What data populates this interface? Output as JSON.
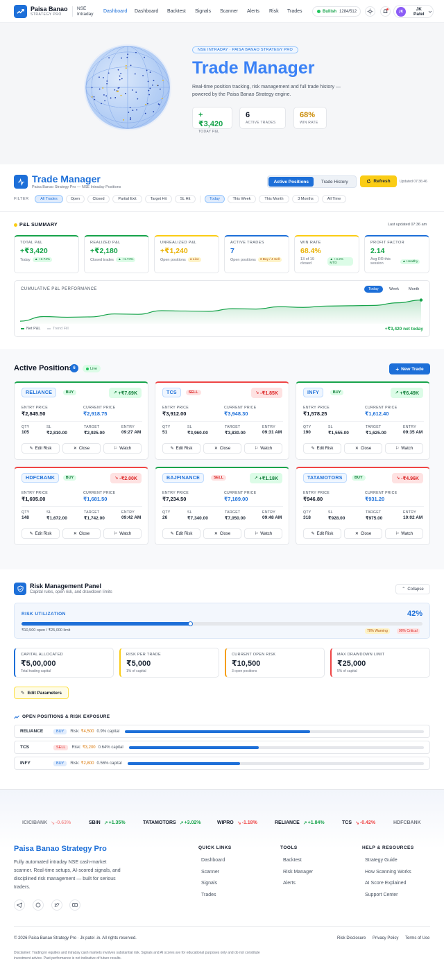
{
  "header": {
    "brand_title": "Paisa Banao",
    "brand_sub": "STRATEGY PRO",
    "market_line1": "NSE",
    "market_line2": "Intraday",
    "nav": [
      "Dashboard",
      "Dashboard",
      "Backtest",
      "Signals",
      "Scanner",
      "Alerts",
      "Risk",
      "Trades"
    ],
    "market_status": "Bullish",
    "market_count": "1284/512",
    "user_initials": "JK",
    "user_name_1": "JK",
    "user_name_2": "Patel"
  },
  "hero": {
    "tag": "NSE INTRADAY · PAISA BANAO STRATEGY PRO",
    "title": "Trade Manager",
    "desc": "Real-time position tracking, risk management and full trade history — powered by the Paisa Banao Strategy engine.",
    "stats": [
      {
        "value": "+₹3,420",
        "label": "TODAY P&L",
        "color": "#16a34a"
      },
      {
        "value": "6",
        "label": "ACTIVE TRADES",
        "color": "#111827"
      },
      {
        "value": "68%",
        "label": "WIN RATE",
        "color": "#ca8a04"
      }
    ]
  },
  "manager": {
    "title": "Trade Manager",
    "subtitle": "Paisa Banao Strategy Pro — NSE Intraday Positions",
    "tab_active": "Active Positions",
    "tab_history": "Trade History",
    "refresh": "Refresh",
    "updated": "Updated 07:36:46",
    "filter_label": "FILTER",
    "filters": [
      "All Trades",
      "Open",
      "Closed",
      "Partial Exit",
      "Target Hit",
      "SL Hit"
    ],
    "periods": [
      "Today",
      "This Week",
      "This Month",
      "3 Months",
      "All Time"
    ]
  },
  "pnl": {
    "title": "P&L SUMMARY",
    "updated": "Last updated 07:36 am",
    "cards": [
      {
        "label": "TOTAL P&L",
        "value": "+₹3,420",
        "sub": "Today",
        "pill": "▲ +2.74%",
        "color": "#16a34a",
        "top": "#16a34a",
        "pill_bg": "#dcfce7",
        "pill_fg": "#15803d"
      },
      {
        "label": "REALIZED P&L",
        "value": "+₹2,180",
        "sub": "Closed trades",
        "pill": "▲ +1.74%",
        "color": "#16a34a",
        "top": "#16a34a",
        "pill_bg": "#dcfce7",
        "pill_fg": "#15803d"
      },
      {
        "label": "UNREALIZED P&L",
        "value": "+₹1,240",
        "sub": "Open positions",
        "pill": "● Live",
        "color": "#eab308",
        "top": "#facc15",
        "pill_bg": "#fef3c7",
        "pill_fg": "#b45309"
      },
      {
        "label": "ACTIVE TRADES",
        "value": "7",
        "sub": "Open positions",
        "pill": "3 Buy / 4 Sell",
        "color": "#1d6fd8",
        "top": "#1d6fd8",
        "pill_bg": "#fef3c7",
        "pill_fg": "#b45309"
      },
      {
        "label": "WIN RATE",
        "value": "68.4%",
        "sub": "13 of 19 closed",
        "pill": "▲ +4.2% MTD",
        "color": "#eab308",
        "top": "#facc15",
        "pill_bg": "#dcfce7",
        "pill_fg": "#15803d"
      },
      {
        "label": "PROFIT FACTOR",
        "value": "2.14",
        "sub": "Avg RR this session",
        "pill": "▲ Healthy",
        "color": "#16a34a",
        "top": "#1d6fd8",
        "pill_bg": "#dcfce7",
        "pill_fg": "#15803d"
      }
    ],
    "chart_title": "CUMULATIVE P&L PERFORMANCE",
    "chart_tabs": [
      "Today",
      "Week",
      "Month"
    ],
    "legend_net": "Net P&L",
    "legend_trend": "Trend Fill",
    "net_today": "+₹3,420 net today"
  },
  "positions": {
    "title": "Active Positions",
    "count": "6",
    "live": "Live",
    "new_trade": "New Trade",
    "labels": {
      "entry": "ENTRY PRICE",
      "current": "CURRENT PRICE",
      "qty": "QTY",
      "sl": "SL",
      "target": "TARGET",
      "entry_t": "ENTRY"
    },
    "btn_edit": "Edit Risk",
    "btn_close": "Close",
    "btn_watch": "Watch",
    "items": [
      {
        "symbol": "RELIANCE",
        "side": "BUY",
        "pnl": "+₹7.69K",
        "entry": "₹2,845.50",
        "current": "₹2,918.75",
        "qty": "105",
        "sl": "₹2,810.00",
        "target": "₹2,925.00",
        "time": "09:27 AM"
      },
      {
        "symbol": "TCS",
        "side": "SELL",
        "pnl": "-₹1.85K",
        "entry": "₹3,912.00",
        "current": "₹3,948.30",
        "qty": "51",
        "sl": "₹3,960.00",
        "target": "₹3,830.00",
        "time": "09:31 AM"
      },
      {
        "symbol": "INFY",
        "side": "BUY",
        "pnl": "+₹6.49K",
        "entry": "₹1,578.25",
        "current": "₹1,612.40",
        "qty": "190",
        "sl": "₹1,555.00",
        "target": "₹1,625.00",
        "time": "09:35 AM"
      },
      {
        "symbol": "HDFCBANK",
        "side": "BUY",
        "pnl": "-₹2.00K",
        "entry": "₹1,695.00",
        "current": "₹1,681.50",
        "qty": "148",
        "sl": "₹1,672.00",
        "target": "₹1,742.00",
        "time": "09:42 AM"
      },
      {
        "symbol": "BAJFINANCE",
        "side": "SELL",
        "pnl": "+₹1.18K",
        "entry": "₹7,234.50",
        "current": "₹7,189.00",
        "qty": "26",
        "sl": "₹7,340.00",
        "target": "₹7,050.00",
        "time": "09:48 AM"
      },
      {
        "symbol": "TATAMOTORS",
        "side": "BUY",
        "pnl": "-₹4.96K",
        "entry": "₹946.80",
        "current": "₹931.20",
        "qty": "318",
        "sl": "₹928.00",
        "target": "₹975.00",
        "time": "10:02 AM"
      }
    ]
  },
  "risk": {
    "title": "Risk Management Panel",
    "subtitle": "Capital rules, open risk, and drawdown limits",
    "collapse": "Collapse",
    "util_label": "RISK UTILIZATION",
    "util_value": "42%",
    "util_fraction": 0.42,
    "util_sub": "₹10,500 open / ₹25,000 limit",
    "warn": "70% Warning",
    "crit": "90% Critical",
    "cards": [
      {
        "label": "CAPITAL ALLOCATED",
        "value": "₹5,00,000",
        "sub": "Total trading capital",
        "accent": "#1d6fd8"
      },
      {
        "label": "RISK PER TRADE",
        "value": "₹5,000",
        "sub": "1% of capital",
        "accent": "#facc15"
      },
      {
        "label": "CURRENT OPEN RISK",
        "value": "₹10,500",
        "sub": "3 open positions",
        "accent": "#f59e0b"
      },
      {
        "label": "MAX DRAWDOWN LIMIT",
        "value": "₹25,000",
        "sub": "5% of capital",
        "accent": "#ef4444"
      }
    ],
    "edit": "Edit Parameters",
    "exposure_title": "OPEN POSITIONS & RISK EXPOSURE",
    "exposure": [
      {
        "symbol": "RELIANCE",
        "side": "BUY",
        "risk_label": "Risk:",
        "risk": "₹4,500",
        "cap": "0.9% capital",
        "fraction": 0.62
      },
      {
        "symbol": "TCS",
        "side": "SELL",
        "risk_label": "Risk:",
        "risk": "₹3,200",
        "cap": "0.64% capital",
        "fraction": 0.44
      },
      {
        "symbol": "INFY",
        "side": "BUY",
        "risk_label": "Risk:",
        "risk": "₹2,800",
        "cap": "0.56% capital",
        "fraction": 0.38
      }
    ]
  },
  "ticker": [
    {
      "sym": "ICICIBANK",
      "chg": "-0.63%",
      "up": false
    },
    {
      "sym": "SBIN",
      "chg": "+1.35%",
      "up": true
    },
    {
      "sym": "TATAMOTORS",
      "chg": "+3.02%",
      "up": true
    },
    {
      "sym": "WIPRO",
      "chg": "-1.18%",
      "up": false
    },
    {
      "sym": "RELIANCE",
      "chg": "+1.84%",
      "up": true
    },
    {
      "sym": "TCS",
      "chg": "-0.42%",
      "up": false
    },
    {
      "sym": "HDFCBANK",
      "chg": "",
      "up": true
    }
  ],
  "footer": {
    "brand": "Paisa Banao Strategy Pro",
    "about": "Fully automated intraday NSE cash-market scanner. Real-time setups, AI-scored signals, and disciplined risk management — built for serious traders.",
    "quick_title": "QUICK LINKS",
    "quick": [
      "Dashboard",
      "Scanner",
      "Signals",
      "Trades"
    ],
    "tools_title": "TOOLS",
    "tools": [
      "Backtest",
      "Risk Manager",
      "Alerts"
    ],
    "help_title": "HELP & RESOURCES",
    "help": [
      "Strategy Guide",
      "How Scanning Works",
      "AI Score Explained",
      "Support Center"
    ],
    "copyright": "© 2026 Paisa Banao Strategy Pro · Jk patel .in. All rights reserved.",
    "legal": [
      "Risk Disclosure",
      "Privacy Policy",
      "Terms of Use"
    ],
    "disclaimer": "Disclaimer: Trading in equities and intraday cash markets involves substantial risk. Signals and AI scores are for educational purposes only and do not constitute investment advice. Past performance is not indicative of future results."
  },
  "chart_data": {
    "type": "area",
    "title": "CUMULATIVE P&L PERFORMANCE",
    "series": [
      {
        "name": "Net P&L",
        "values": [
          200,
          900,
          800,
          850,
          1300,
          1250,
          1800,
          1750,
          1700,
          2100,
          2050,
          2400,
          2300,
          2500,
          2550,
          2600,
          3000,
          3420
        ]
      }
    ],
    "legend_position": "bottom-left"
  }
}
